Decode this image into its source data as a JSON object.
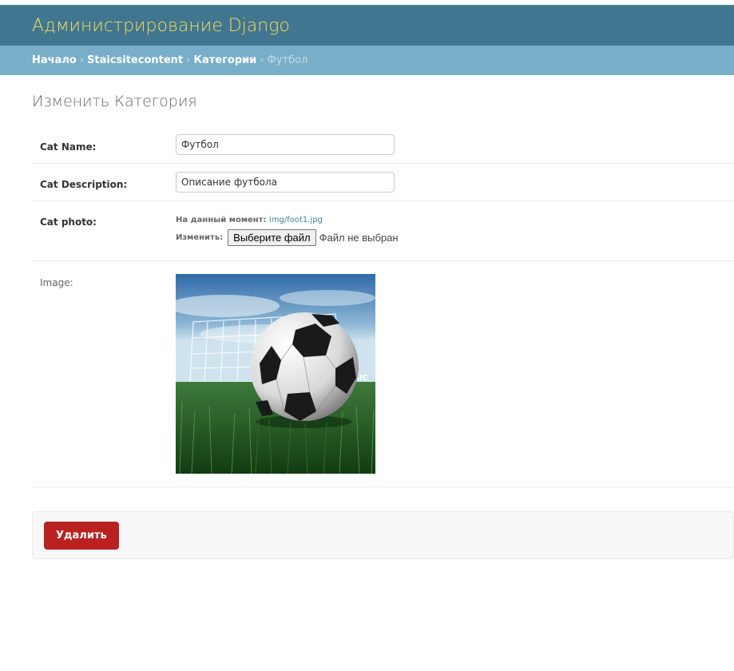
{
  "header": {
    "branding": "Администрирование Django"
  },
  "breadcrumbs": {
    "items": [
      "Начало",
      "Staicsitecontent",
      "Категории"
    ],
    "separator": "›",
    "current": "Футбол"
  },
  "page": {
    "title": "Изменить Категория"
  },
  "form": {
    "cat_name": {
      "label": "Cat Name:",
      "value": "Футбол"
    },
    "cat_description": {
      "label": "Cat Description:",
      "value": "Описание футбола"
    },
    "cat_photo": {
      "label": "Cat photo:",
      "current_label": "На данный момент:",
      "current_file": "img/foot1.jpg",
      "change_label": "Изменить:",
      "choose_button": "Выберите файл",
      "no_file_text": "Файл не выбран"
    },
    "image": {
      "label": "Image:",
      "goal_text": "AIC"
    }
  },
  "actions": {
    "delete_label": "Удалить"
  },
  "colors": {
    "header_bg": "#417690",
    "branding": "#f5dd5d",
    "breadcrumbs_bg": "#79aec8",
    "delete_bg": "#ba2121",
    "link": "#447e9b"
  }
}
